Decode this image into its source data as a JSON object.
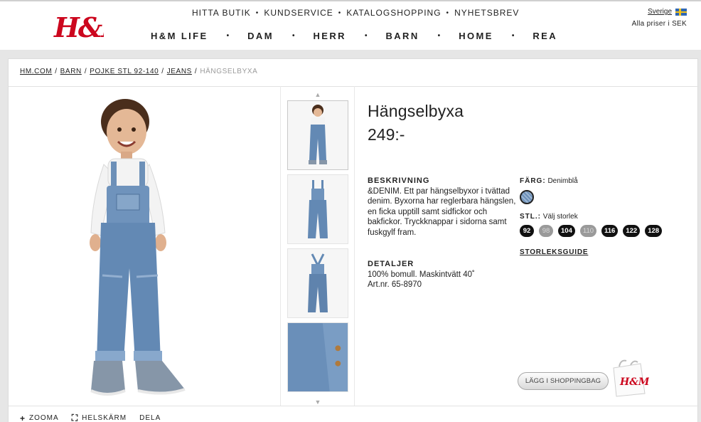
{
  "header": {
    "utility_nav": [
      "HITTA BUTIK",
      "KUNDSERVICE",
      "KATALOGSHOPPING",
      "NYHETSBREV"
    ],
    "main_nav": [
      "H&M LIFE",
      "DAM",
      "HERR",
      "BARN",
      "HOME",
      "REA"
    ],
    "country": "Sverige",
    "currency_note": "Alla priser i SEK",
    "logo_text": "H&M"
  },
  "breadcrumb": {
    "items": [
      "HM.COM",
      "BARN",
      "POJKE STL 92-140",
      "JEANS"
    ],
    "current": "HÄNGSELBYXA"
  },
  "product": {
    "title": "Hängselbyxa",
    "price": "249:-",
    "description_title": "BESKRIVNING",
    "description": "&DENIM. Ett par hängselbyxor i tvättad denim. Byxorna har reglerbara hängslen, en ficka upptill samt sidfickor och bakfickor. Tryckknappar i sidorna samt fuskgylf fram.",
    "details_title": "DETALJER",
    "details_lines": [
      "100% bomull. Maskintvätt 40˚",
      "Art.nr. 65-8970"
    ]
  },
  "options": {
    "color_label": "FÄRG:",
    "color_value": "Denimblå",
    "size_label": "STL.:",
    "size_prompt": "Välj storlek",
    "sizes": [
      {
        "label": "92",
        "available": true
      },
      {
        "label": "98",
        "available": false
      },
      {
        "label": "104",
        "available": true
      },
      {
        "label": "110",
        "available": false
      },
      {
        "label": "116",
        "available": true
      },
      {
        "label": "122",
        "available": true
      },
      {
        "label": "128",
        "available": true
      }
    ],
    "size_guide": "STORLEKSGUIDE"
  },
  "cart": {
    "button_label": "LÄGG I SHOPPINGBAG"
  },
  "tools": {
    "zoom": "ZOOMA",
    "fullscreen": "HELSKÄRM",
    "share": "DELA"
  },
  "colors": {
    "brand_red": "#cc071e",
    "denim": "#5f83ad"
  }
}
